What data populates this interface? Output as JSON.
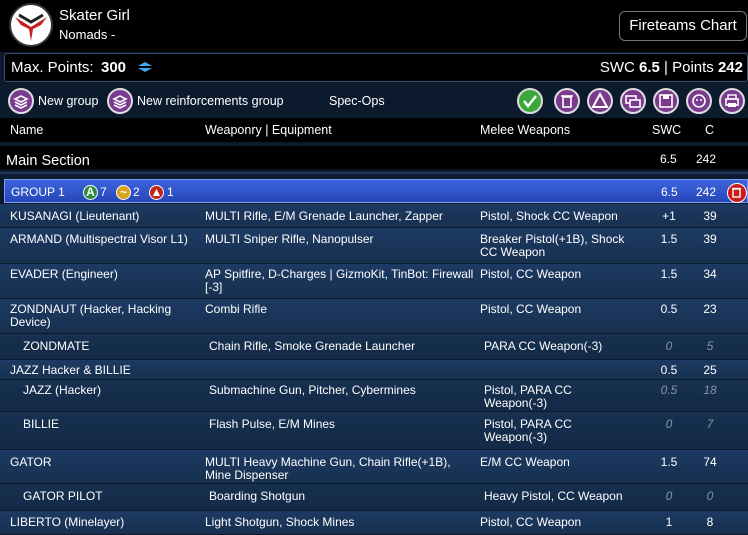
{
  "header": {
    "army_name": "Skater Girl",
    "army_sub": "Nomads -",
    "fireteams_label": "Fireteams Chart"
  },
  "points": {
    "max_label": "Max. Points:",
    "max_value": "300",
    "swc_label": "SWC",
    "swc_value": "6.5",
    "points_label": "| Points",
    "points_value": "242"
  },
  "toolbar": {
    "new_group": "New group",
    "new_reinforcements": "New reinforcements group",
    "spec_ops": "Spec-Ops"
  },
  "columns": {
    "name": "Name",
    "weaponry": "Weaponry | Equipment",
    "melee": "Melee Weapons",
    "swc": "SWC",
    "cost": "C"
  },
  "section": {
    "title": "Main Section",
    "swc": "6.5",
    "cost": "242"
  },
  "group": {
    "label": "GROUP 1",
    "regular_count": "7",
    "irregular_count": "2",
    "impetuous_count": "1",
    "swc": "6.5",
    "cost": "242"
  },
  "rows": [
    {
      "name": "KUSANAGI (Lieutenant)",
      "weapons": "MULTI Rifle, E/M Grenade Launcher, Zapper",
      "melee": "Pistol, Shock CC Weapon",
      "swc": "+1",
      "cost": "39"
    },
    {
      "name": "ARMAND (Multispectral Visor L1)",
      "weapons": "MULTI Sniper Rifle, Nanopulser",
      "melee": "Breaker Pistol(+1B), Shock CC Weapon",
      "swc": "1.5",
      "cost": "39"
    },
    {
      "name": "EVADER (Engineer)",
      "weapons": "AP Spitfire, D-Charges | GizmoKit, TinBot: Firewall [-3]",
      "melee": "Pistol, CC Weapon",
      "swc": "1.5",
      "cost": "34"
    },
    {
      "name": "ZONDNAUT (Hacker, Hacking Device)",
      "weapons": "Combi Rifle",
      "melee": "Pistol, CC Weapon",
      "swc": "0.5",
      "cost": "23"
    },
    {
      "name": "ZONDMATE",
      "weapons": "Chain Rifle, Smoke Grenade Launcher",
      "melee": "PARA CC Weapon(-3)",
      "swc": "0",
      "cost": "5"
    },
    {
      "name": "JAZZ Hacker & BILLIE",
      "weapons": "",
      "melee": "",
      "swc": "0.5",
      "cost": "25"
    },
    {
      "name": "JAZZ (Hacker)",
      "weapons": "Submachine Gun, Pitcher, Cybermines",
      "melee": "Pistol, PARA CC Weapon(-3)",
      "swc": "0.5",
      "cost": "18"
    },
    {
      "name": "BILLIE",
      "weapons": "Flash Pulse, E/M Mines",
      "melee": "Pistol, PARA CC Weapon(-3)",
      "swc": "0",
      "cost": "7"
    },
    {
      "name": "GATOR",
      "weapons": "MULTI Heavy Machine Gun, Chain Rifle(+1B), Mine Dispenser",
      "melee": "E/M CC Weapon",
      "swc": "1.5",
      "cost": "74"
    },
    {
      "name": "GATOR PILOT",
      "weapons": "Boarding Shotgun",
      "melee": "Heavy Pistol, CC Weapon",
      "swc": "0",
      "cost": "0"
    },
    {
      "name": "LIBERTO (Minelayer)",
      "weapons": "Light Shotgun, Shock Mines",
      "melee": "Pistol, CC Weapon",
      "swc": "1",
      "cost": "8"
    }
  ]
}
